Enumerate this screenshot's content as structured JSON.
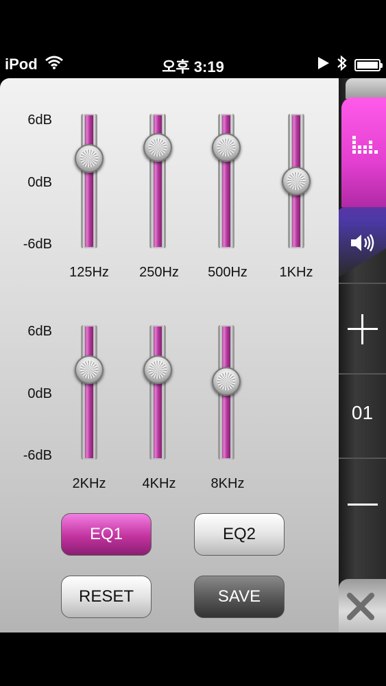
{
  "status_bar": {
    "carrier": "iPod",
    "time": "오후 3:19"
  },
  "eq": {
    "db_labels": {
      "top": "6dB",
      "mid": "0dB",
      "bottom": "-6dB"
    },
    "bands": [
      {
        "label": "125Hz",
        "level_db": 2.0
      },
      {
        "label": "250Hz",
        "level_db": 3.0
      },
      {
        "label": "500Hz",
        "level_db": 3.0
      },
      {
        "label": "1KHz",
        "level_db": 0.0
      },
      {
        "label": "2KHz",
        "level_db": 2.0
      },
      {
        "label": "4KHz",
        "level_db": 2.0
      },
      {
        "label": "8KHz",
        "level_db": 1.0
      }
    ]
  },
  "buttons": {
    "eq1": "EQ1",
    "eq2": "EQ2",
    "reset": "RESET",
    "save": "SAVE"
  },
  "sidebar": {
    "preset_number": "01"
  },
  "colors": {
    "accent": "#e23fd0",
    "slider_track": "#b6389e"
  }
}
